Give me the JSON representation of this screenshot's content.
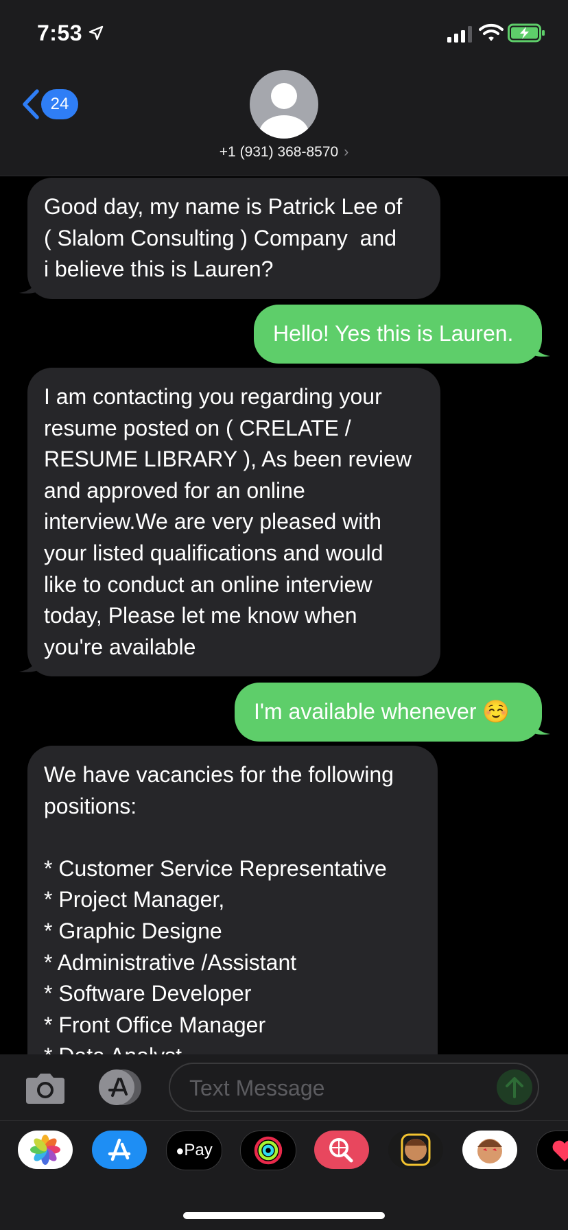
{
  "status_bar": {
    "time": "7:53"
  },
  "header": {
    "back_badge": "24",
    "contact": "+1 (931) 368-8570"
  },
  "messages": [
    {
      "dir": "in",
      "text": "Good day, my name is Patrick Lee of\n( Slalom Consulting ) Company  and\ni believe this is Lauren?"
    },
    {
      "dir": "out",
      "text": "Hello! Yes this is Lauren."
    },
    {
      "dir": "in",
      "text": "I am contacting you regarding your\nresume posted on ( CRELATE /\nRESUME LIBRARY ), As been review\nand approved for an online\ninterview.We are very pleased with\nyour listed qualifications and would\nlike to conduct an online interview\ntoday, Please let me know when\nyou're available"
    },
    {
      "dir": "out",
      "text": "I'm available whenever ☺️"
    },
    {
      "dir": "in",
      "text": "We have vacancies for the following\npositions:\n\n* Customer Service Representative\n* Project Manager,\n* Graphic Designe\n* Administrative /Assistant\n* Software Developer\n* Front Office Manager\n* Data Analyst"
    }
  ],
  "compose": {
    "placeholder": "Text Message"
  },
  "app_drawer": {
    "apps": [
      {
        "name": "photos-app-icon",
        "bg": "#ffffff"
      },
      {
        "name": "app-store-app-icon",
        "bg": "#1e8ef4"
      },
      {
        "name": "apple-pay-app-icon",
        "bg": "#000000",
        "label": "Pay"
      },
      {
        "name": "activity-app-icon",
        "bg": "#000000"
      },
      {
        "name": "web-images-app-icon",
        "bg": "#e8475e"
      },
      {
        "name": "memoji-app-icon",
        "bg": "#1a1a1a"
      },
      {
        "name": "animoji-app-icon",
        "bg": "#ffffff"
      },
      {
        "name": "digital-touch-app-icon",
        "bg": "#000000"
      }
    ]
  }
}
